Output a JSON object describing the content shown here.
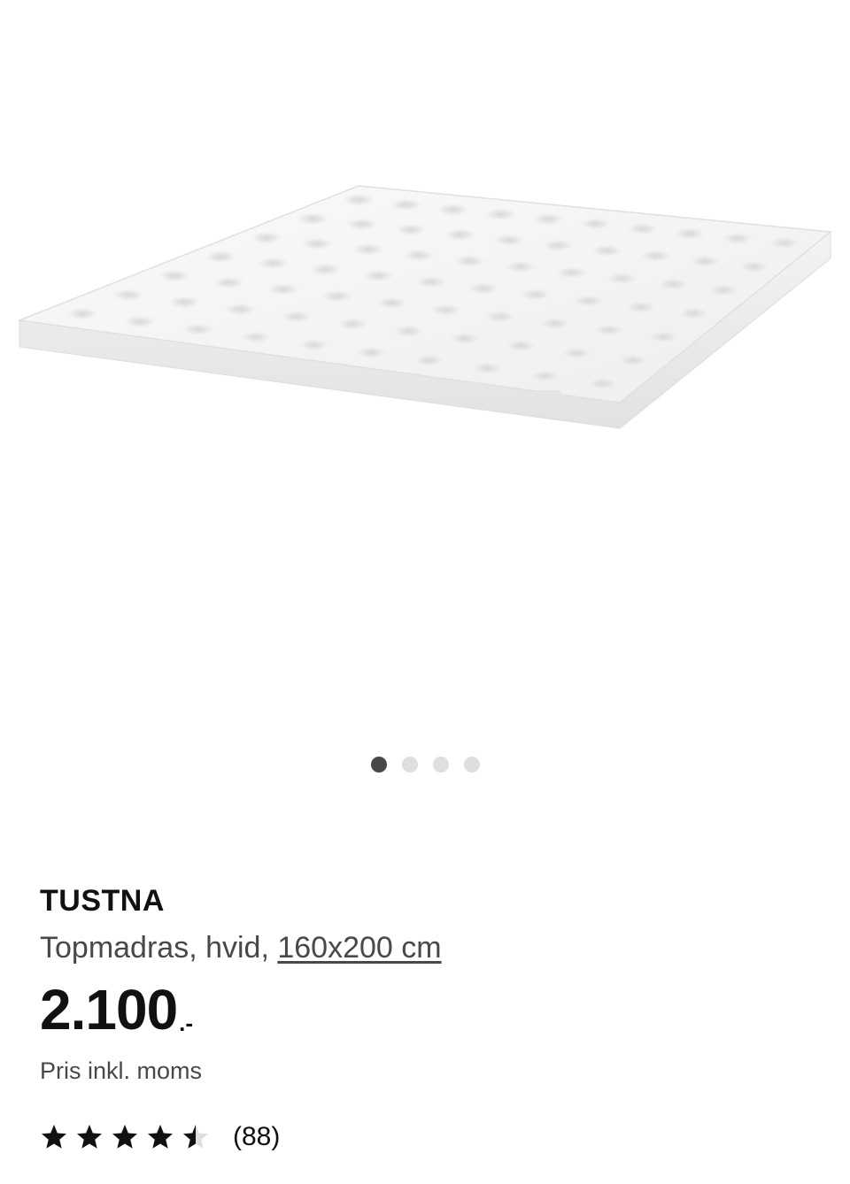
{
  "carousel": {
    "count": 4,
    "active_index": 0
  },
  "product": {
    "name": "TUSTNA",
    "description_prefix": "Topmadras, hvid, ",
    "size_link": "160x200 cm",
    "price": "2.100",
    "price_suffix": ".-",
    "price_note": "Pris inkl. moms",
    "rating": 4.5,
    "review_count": "(88)"
  },
  "colors": {
    "text_primary": "#111111",
    "text_secondary": "#484848",
    "dot_active": "#484848",
    "dot_inactive": "#dfdfdf"
  }
}
